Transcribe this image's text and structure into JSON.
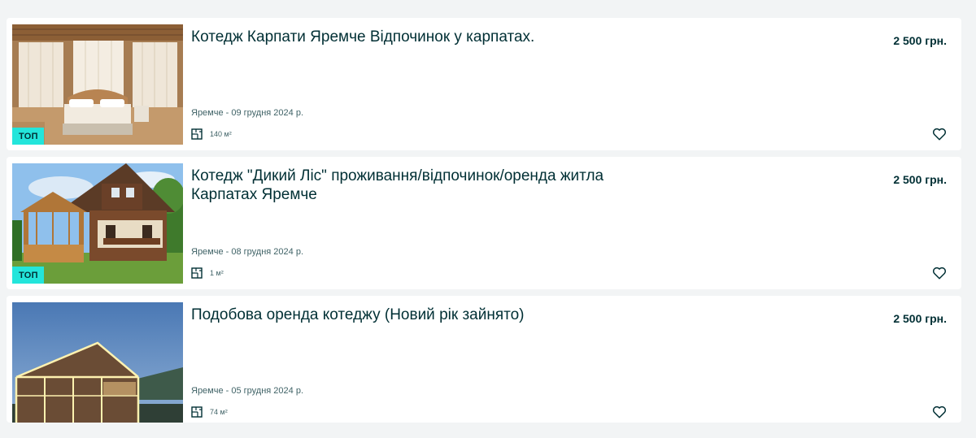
{
  "listings": [
    {
      "title": "Котедж Карпати Яремче Відпочинок у карпатах.",
      "price": "2 500 грн.",
      "location_date": "Яремче - 09 грудня 2024 р.",
      "area": "140 м²",
      "badge": "ТОП"
    },
    {
      "title": "Котедж \"Дикий Ліс\" проживання/відпочинок/оренда житла Карпатах Яремче",
      "price": "2 500 грн.",
      "location_date": "Яремче - 08 грудня 2024 р.",
      "area": "1 м²",
      "badge": "ТОП"
    },
    {
      "title": "Подобова оренда котеджу (Новий рік зайнято)",
      "price": "2 500 грн.",
      "location_date": "Яремче - 05 грудня 2024 р.",
      "area": "74 м²"
    }
  ],
  "colors": {
    "background": "#f2f4f5",
    "card": "#ffffff",
    "text": "#002f34",
    "badge": "#23e5db"
  },
  "icons": {
    "area": "floor-plan-icon",
    "favorite": "heart-outline-icon"
  }
}
